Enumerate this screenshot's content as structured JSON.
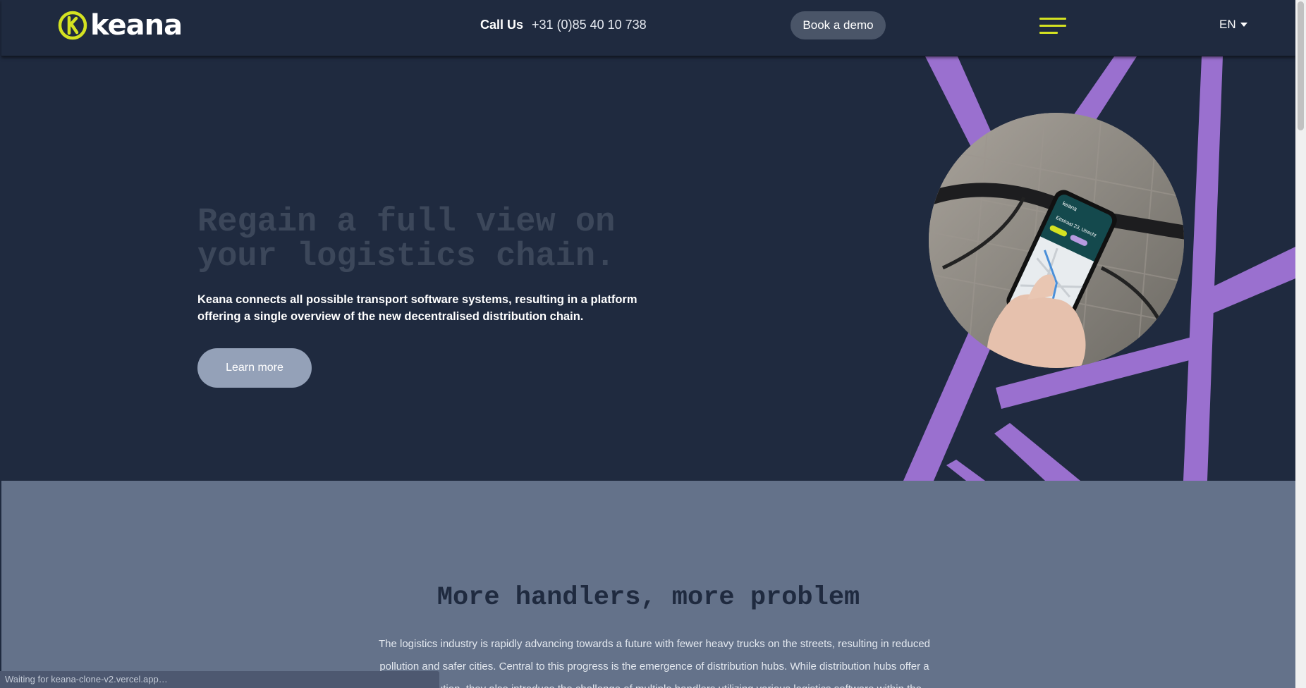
{
  "header": {
    "logo_text": "keana",
    "call_label": "Call Us",
    "phone": "+31 (0)85 40 10 738",
    "demo_button": "Book a demo",
    "language": "EN"
  },
  "hero": {
    "title": "Regain a full view on your logistics chain.",
    "subtitle": "Keana connects all possible transport software systems, resulting in a platform offering a single overview of the new decentralised distribution chain.",
    "cta": "Learn more",
    "phone_screen_brand": "keana",
    "phone_screen_address": "Ettstraat 23, Utrecht"
  },
  "section2": {
    "title": "More handlers, more problem",
    "body": "The logistics industry is rapidly advancing towards a future with fewer heavy trucks on the streets, resulting in reduced pollution and safer cities. Central to this progress is the emergence of distribution hubs. While distribution hubs offer a brilliant solution, they also introduce the challenge of multiple handlers utilizing various logistics software within the"
  },
  "status_bar": "Waiting for keana-clone-v2.vercel.app…",
  "colors": {
    "navy": "#1f2a3f",
    "accent_yellow": "#d4e221",
    "purple": "#9a70cf",
    "slate": "#64728a"
  }
}
